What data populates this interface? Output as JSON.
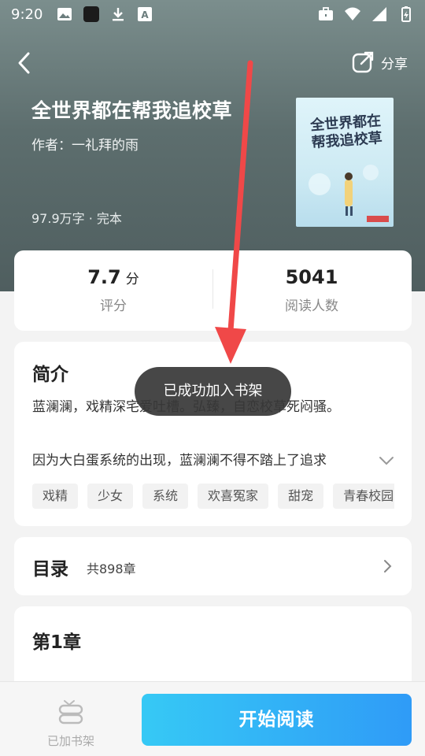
{
  "status_bar": {
    "time": "9:20",
    "icons_left": [
      "image-icon",
      "square-icon",
      "download-icon",
      "a-icon"
    ],
    "icons_right": [
      "briefcase-icon",
      "wifi-icon",
      "signal-icon",
      "battery-icon"
    ]
  },
  "header": {
    "share_label": "分享"
  },
  "book": {
    "title": "全世界都在帮我追校草",
    "author": "作者：一礼拜的雨",
    "meta": "97.9万字 · 完本",
    "cover_title": "全世界都在帮我追校草"
  },
  "stats": {
    "rating_value": "7.7",
    "rating_unit": "分",
    "rating_label": "评分",
    "readers_value": "5041",
    "readers_label": "阅读人数"
  },
  "intro": {
    "heading": "简介",
    "text": "蓝澜澜，戏精深宅爱吐槽。弘臻，自恋校草死闷骚。",
    "more": "因为大白蛋系统的出现，蓝澜澜不得不踏上了追求",
    "tags": [
      "戏精",
      "少女",
      "系统",
      "欢喜冤家",
      "甜宠",
      "青春校园"
    ]
  },
  "toc": {
    "heading": "目录",
    "count": "共898章"
  },
  "chapter": {
    "title": "第1章"
  },
  "bottom": {
    "shelf_label": "已加书架",
    "read_label": "开始阅读"
  },
  "toast": {
    "text": "已成功加入书架"
  },
  "colors": {
    "accent_start": "#36c9f5",
    "accent_end": "#2f9bf7",
    "annotation_arrow": "#f04848"
  }
}
